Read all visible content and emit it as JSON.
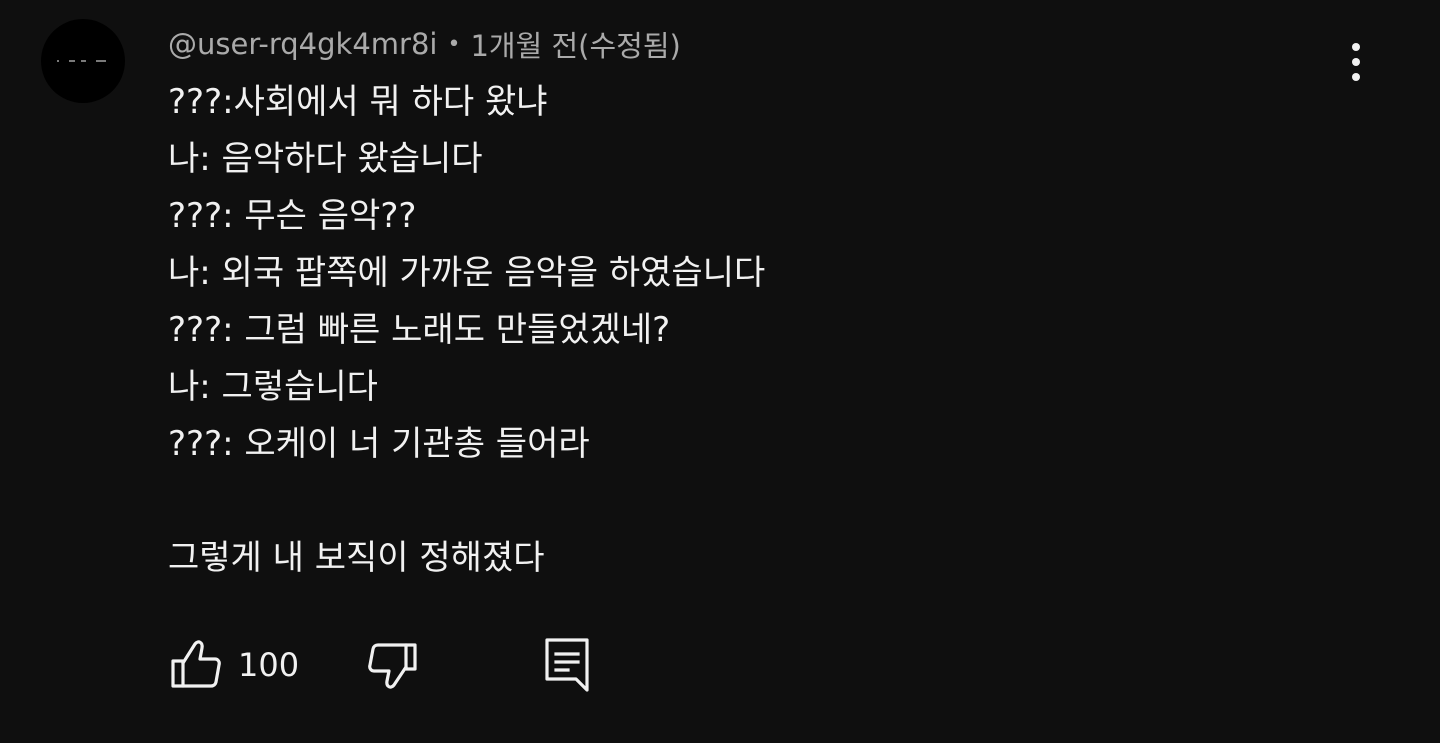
{
  "comment": {
    "author": "@user-rq4gk4mr8i",
    "separator": "•",
    "timestamp": "1개월 전(수정됨)",
    "lines": [
      "???:사회에서 뭐 하다 왔냐",
      "나: 음악하다 왔습니다",
      "???: 무슨 음악??",
      "나: 외국 팝쪽에 가까운 음악을 하였습니다",
      "???: 그럼 빠른 노래도 만들었겠네?",
      "나: 그렇습니다",
      "???: 오케이 너 기관총 들어라",
      "",
      "그렇게 내 보직이 정해졌다"
    ],
    "like_count": "100"
  },
  "icons": {
    "more": "more-vertical-icon",
    "like": "thumbs-up-icon",
    "dislike": "thumbs-down-icon",
    "reply": "reply-comment-icon"
  },
  "colors": {
    "background": "#0f0f0f",
    "text": "#f1f1f1",
    "secondary_text": "#aaaaaa"
  }
}
